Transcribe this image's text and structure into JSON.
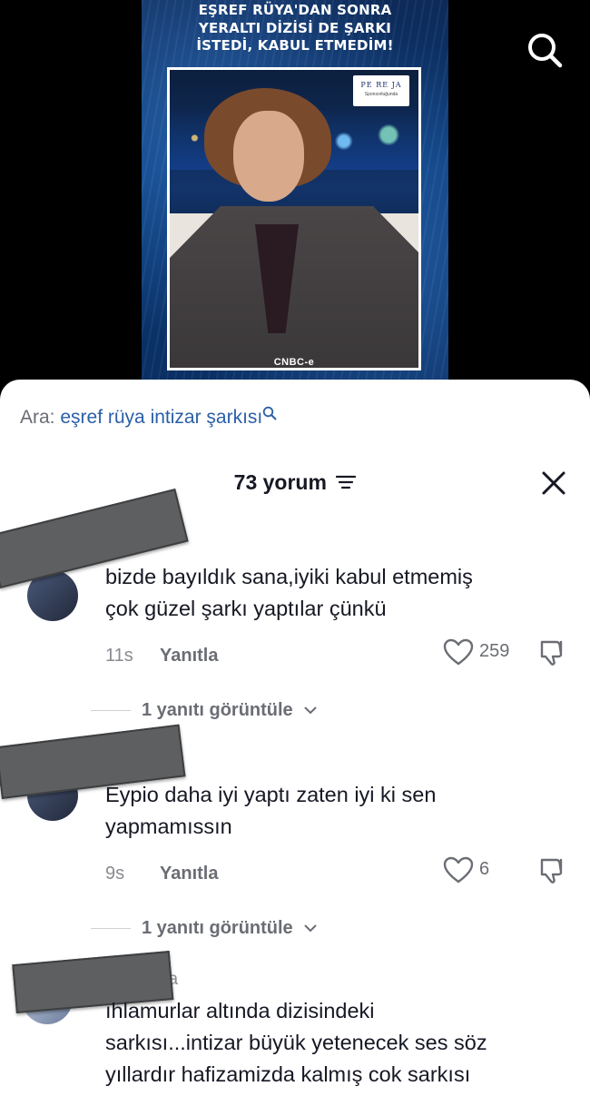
{
  "video": {
    "headline_lines": [
      "EŞREF RÜYA'DAN SONRA",
      "YERALTI DİZİSİ DE ŞARKI",
      "İSTEDİ, KABUL ETMEDİM!"
    ],
    "sponsor_logo": "PE RE JA",
    "sponsor_sub": "Sponsorluğunda",
    "channel": "CNBC-e",
    "search_icon": "search-icon"
  },
  "sheet": {
    "related_prefix": "Ara:",
    "related_query": "eşref rüya intizar şarkısı",
    "comment_count": "73 yorum",
    "filter_icon": "filter-icon",
    "close_icon": "close-icon"
  },
  "comments": [
    {
      "username": "",
      "text_lines": [
        "bizde bayıldık sana,iyiki kabul etmemiş",
        "çok güzel şarkı yaptılar çünkü"
      ],
      "time": "11s",
      "reply_label": "Yanıtla",
      "likes": "259",
      "view_replies": "1 yanıtı görüntüle"
    },
    {
      "username": "",
      "text_lines": [
        "Eypio daha iyi yaptı zaten iyi ki sen",
        "yapmamıssın"
      ],
      "time": "9s",
      "reply_label": "Yanıtla",
      "likes": "6",
      "view_replies": "1 yanıtı görüntüle"
    },
    {
      "username": "za",
      "text_lines": [
        "ıhlamurlar altında dizisindeki",
        "sarkısı...intizar büyük yetenecek ses söz",
        "yıllardır hafizamizda kalmış cok sarkısı"
      ]
    }
  ],
  "colors": {
    "accent_link": "#2a5fa8",
    "muted": "#8a8b91",
    "redaction": "#5e5f61"
  }
}
